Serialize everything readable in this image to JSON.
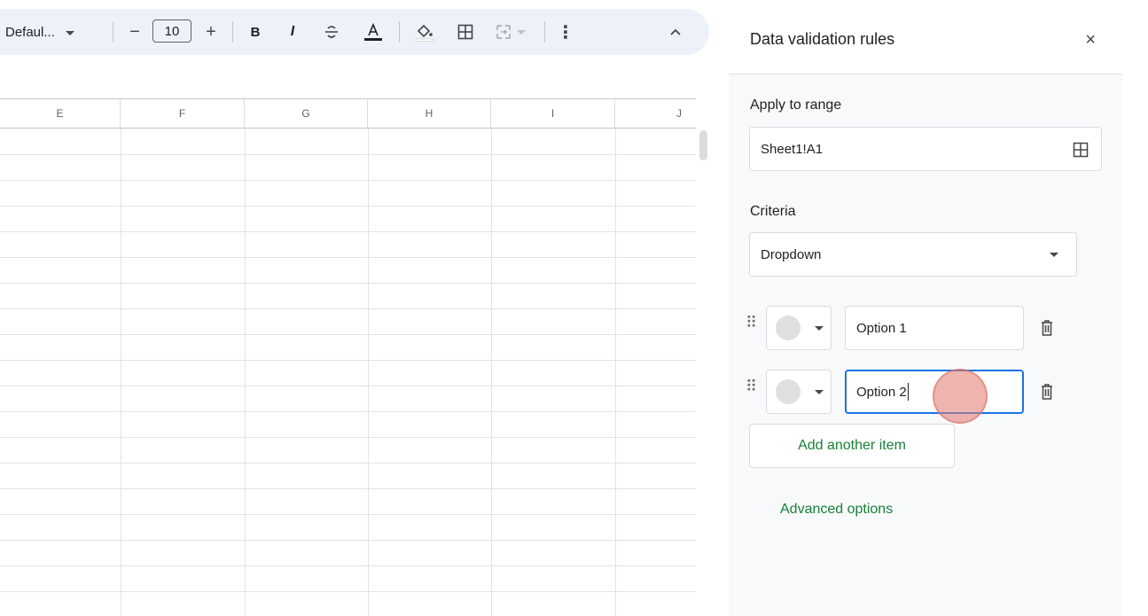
{
  "toolbar": {
    "font_name": "Defaul...",
    "font_size": "10",
    "minus_label": "−",
    "plus_label": "+",
    "bold_label": "B",
    "italic_label": "I",
    "more_label": "⋮",
    "collapse_label": "^"
  },
  "grid": {
    "columns": [
      "E",
      "F",
      "G",
      "H",
      "I",
      "J"
    ]
  },
  "panel": {
    "title": "Data validation rules",
    "close_label": "×",
    "apply_to_range_label": "Apply to range",
    "range_value": "Sheet1!A1",
    "criteria_label": "Criteria",
    "criteria_value": "Dropdown",
    "items": [
      {
        "value": "Option 1"
      },
      {
        "value": "Option 2"
      }
    ],
    "add_item_label": "Add another item",
    "advanced_options_label": "Advanced options"
  },
  "colors": {
    "accent_green": "#188038",
    "focus_blue": "#1a73e8",
    "toolbar_bg": "#edf2fa"
  }
}
